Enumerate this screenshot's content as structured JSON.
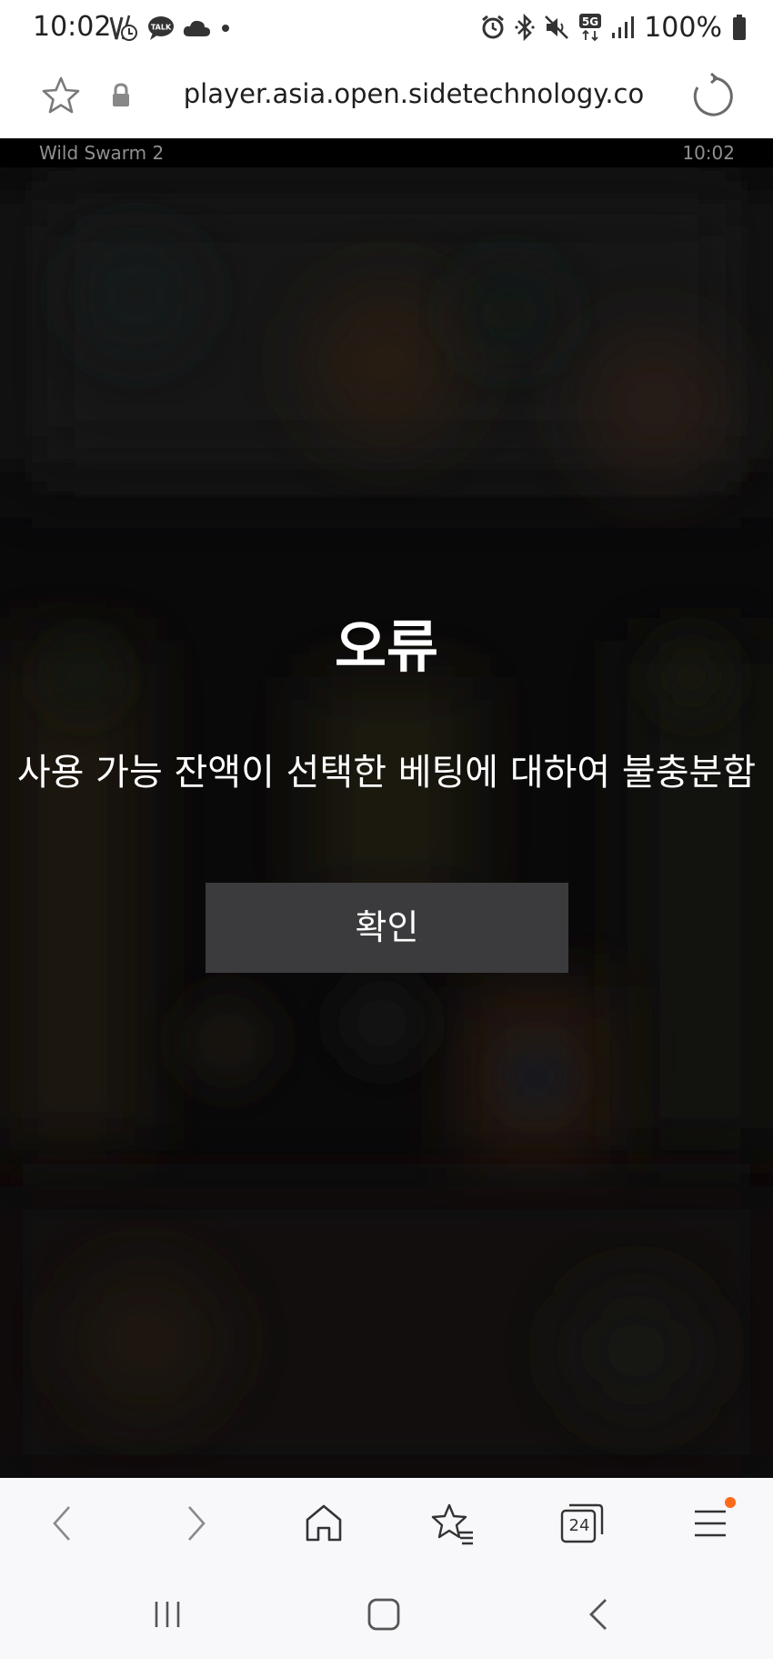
{
  "status_bar": {
    "time": "10:02",
    "left_icons": [
      "data-call-icon",
      "kakaotalk-icon",
      "cloud-icon",
      "dot-icon"
    ],
    "kakaotalk_label": "TALK",
    "right_icons": [
      "alarm-icon",
      "bluetooth-icon",
      "mute-icon",
      "5g-icon",
      "signal-icon",
      "battery-icon"
    ],
    "network_label": "5G",
    "battery": "100%"
  },
  "browser": {
    "url": "player.asia.open.sidetechnology.co",
    "tab_count": "24",
    "accent_color": "#ff6a1a"
  },
  "game": {
    "title": "Wild Swarm 2",
    "clock": "10:02"
  },
  "dialog": {
    "title": "오류",
    "message": "사용 가능 잔액이 선택한 베팅에 대하여 불충분함",
    "confirm_label": "확인"
  }
}
